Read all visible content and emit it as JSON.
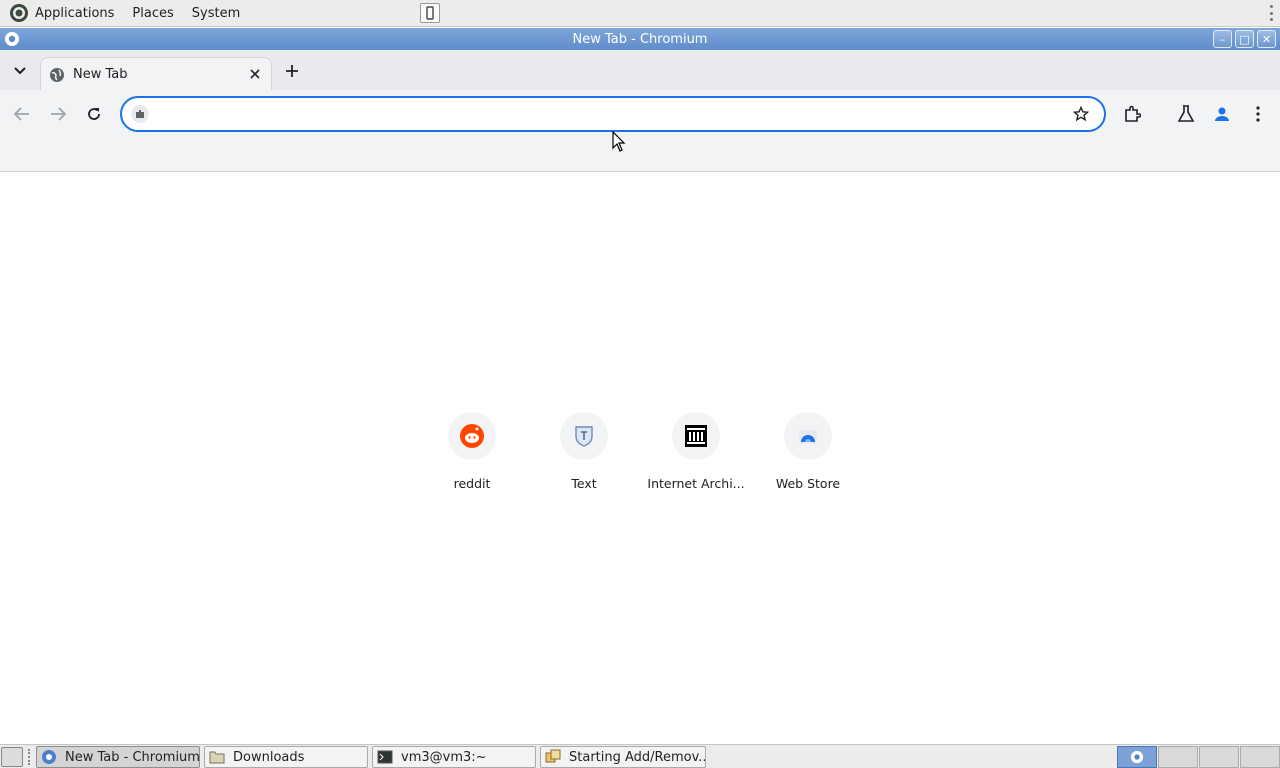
{
  "top_panel": {
    "menus": [
      "Applications",
      "Places",
      "System"
    ]
  },
  "window": {
    "title": "New Tab - Chromium"
  },
  "browser": {
    "tabs": [
      {
        "title": "New Tab",
        "active": true
      }
    ],
    "omnibox": {
      "value": "",
      "placeholder": ""
    }
  },
  "new_tab_page": {
    "shortcuts": [
      {
        "label": "reddit",
        "icon": "reddit-icon"
      },
      {
        "label": "Text",
        "icon": "text-shield-icon"
      },
      {
        "label": "Internet Archi...",
        "icon": "archive-building-icon"
      },
      {
        "label": "Web Store",
        "icon": "web-store-icon"
      }
    ]
  },
  "taskbar": {
    "tasks": [
      {
        "label": "New Tab - Chromium",
        "icon": "chromium-icon",
        "active": true
      },
      {
        "label": "Downloads",
        "icon": "folder-icon",
        "active": false
      },
      {
        "label": "vm3@vm3:~",
        "icon": "terminal-icon",
        "active": false
      },
      {
        "label": "Starting Add/Remov...",
        "icon": "package-icon",
        "active": false
      }
    ]
  },
  "colors": {
    "accent": "#1a73e8",
    "titlebar": "#6e97cf",
    "reddit": "#ff4500"
  }
}
